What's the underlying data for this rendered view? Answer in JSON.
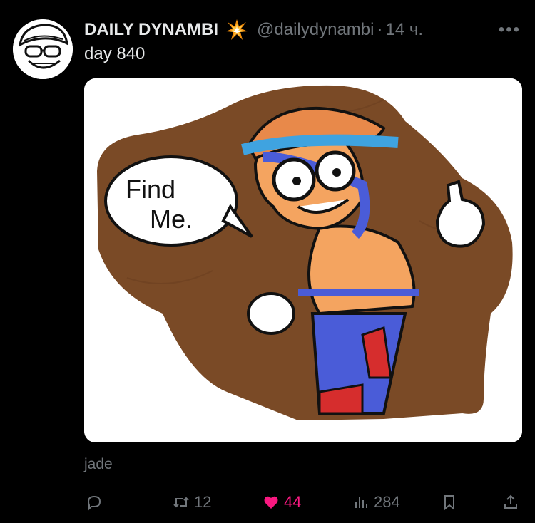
{
  "post": {
    "author_name": "DAILY DYNAMBI",
    "author_emoji_icon": "collision-emoji-icon",
    "handle": "@dailydynambi",
    "separator": "·",
    "time": "14 ч.",
    "more_icon": "more-dots-icon",
    "more_label": "•••",
    "text": "day 840",
    "media_caption": "jade",
    "image_text": "Find Me."
  },
  "actions": {
    "reply_icon": "reply-icon",
    "repost_icon": "repost-icon",
    "repost_count": "12",
    "like_icon": "heart-icon",
    "like_count": "44",
    "views_icon": "views-icon",
    "views_count": "284",
    "bookmark_icon": "bookmark-icon",
    "share_icon": "share-icon"
  },
  "colors": {
    "background": "#000000",
    "text_primary": "#e7e9ea",
    "text_secondary": "#71767b",
    "like": "#f91880"
  }
}
